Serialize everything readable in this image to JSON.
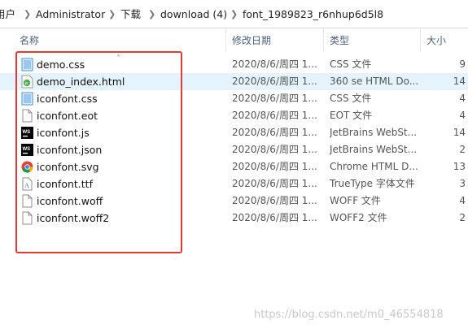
{
  "breadcrumb": [
    "用户",
    "Administrator",
    "下载",
    "download (4)",
    "font_1989823_r6nhup6d5l8"
  ],
  "columns": {
    "name": "名称",
    "date": "修改日期",
    "type": "类型",
    "size": "大小"
  },
  "files": [
    {
      "name": "demo.css",
      "date": "2020/8/6/周四 1...",
      "type": "CSS 文件",
      "size": "9",
      "icon": "css-file-icon"
    },
    {
      "name": "demo_index.html",
      "date": "2020/8/6/周四 1...",
      "type": "360 se HTML Do...",
      "size": "14",
      "icon": "html-file-icon",
      "selected": true
    },
    {
      "name": "iconfont.css",
      "date": "2020/8/6/周四 1...",
      "type": "CSS 文件",
      "size": "4",
      "icon": "css-file-icon"
    },
    {
      "name": "iconfont.eot",
      "date": "2020/8/6/周四 1...",
      "type": "EOT 文件",
      "size": "4",
      "icon": "blank-file-icon"
    },
    {
      "name": "iconfont.js",
      "date": "2020/8/6/周四 1...",
      "type": "JetBrains WebSt...",
      "size": "14",
      "icon": "webstorm-file-icon"
    },
    {
      "name": "iconfont.json",
      "date": "2020/8/6/周四 1...",
      "type": "JetBrains WebSt...",
      "size": "2",
      "icon": "webstorm-file-icon"
    },
    {
      "name": "iconfont.svg",
      "date": "2020/8/6/周四 1...",
      "type": "Chrome HTML D...",
      "size": "13",
      "icon": "chrome-file-icon"
    },
    {
      "name": "iconfont.ttf",
      "date": "2020/8/6/周四 1...",
      "type": "TrueType 字体文件",
      "size": "3",
      "icon": "font-file-icon"
    },
    {
      "name": "iconfont.woff",
      "date": "2020/8/6/周四 1...",
      "type": "WOFF 文件",
      "size": "4",
      "icon": "blank-file-icon"
    },
    {
      "name": "iconfont.woff2",
      "date": "2020/8/6/周四 1...",
      "type": "WOFF2 文件",
      "size": "2",
      "icon": "blank-file-icon"
    }
  ],
  "watermark": "https://blog.csdn.net/m0_46554818",
  "colors": {
    "highlight_box": "#e53935",
    "selected_row": "#e5f3ff",
    "header_text": "#4c607a"
  }
}
